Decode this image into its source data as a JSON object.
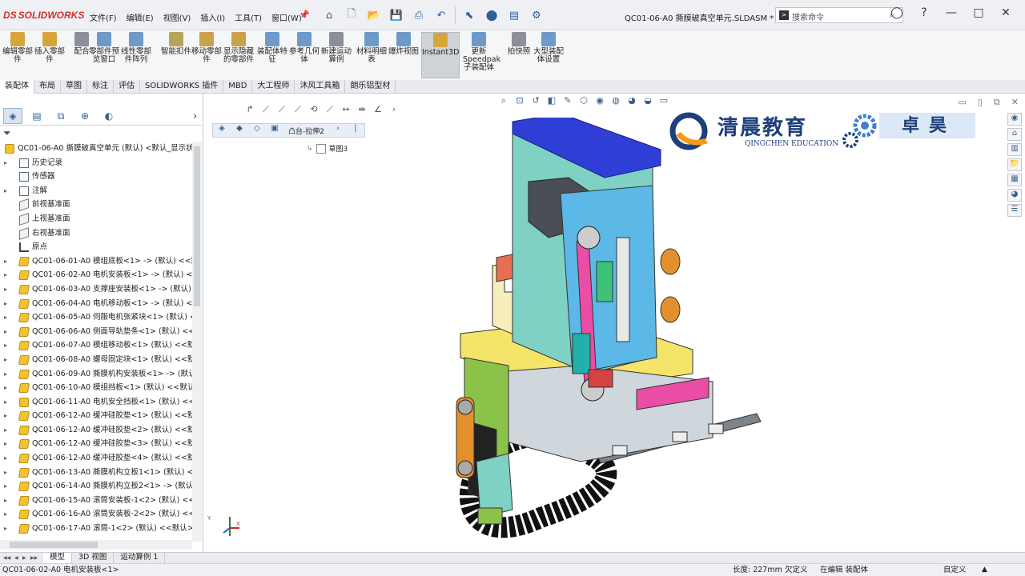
{
  "app": {
    "logo": "SOLIDWORKS",
    "logo_mark": "DS",
    "document_title": "QC01-06-A0 撕膜破真空单元.SLDASM *",
    "search_placeholder": "搜索命令",
    "window_controls": [
      "—",
      "□",
      "✕"
    ]
  },
  "menu": [
    "文件(F)",
    "编辑(E)",
    "视图(V)",
    "插入(I)",
    "工具(T)",
    "窗口(W)"
  ],
  "quick_access": [
    "home-icon",
    "new-icon",
    "open-icon",
    "save-icon",
    "print-icon",
    "undo-icon",
    "select-icon",
    "rebuild-icon",
    "file-properties-icon",
    "options-icon"
  ],
  "ribbon": [
    {
      "label": "编辑零部件",
      "color": "#d8a43c"
    },
    {
      "label": "插入零部件",
      "color": "#d8a43c"
    },
    {
      "label": "配合",
      "color": "#8a8f99"
    },
    {
      "label": "零部件预览窗口",
      "color": "#6d9ac9"
    },
    {
      "label": "线性零部件阵列",
      "color": "#6d9ac9"
    },
    {
      "label": "智能扣件",
      "color": "#b9a35c"
    },
    {
      "label": "移动零部件",
      "color": "#c9a24a"
    },
    {
      "label": "显示隐藏的零部件",
      "color": "#c9a24a"
    },
    {
      "label": "装配体特征",
      "color": "#6d9ac9"
    },
    {
      "label": "参考几何体",
      "color": "#6d9ac9"
    },
    {
      "label": "新建运动算例",
      "color": "#8a8f99"
    },
    {
      "label": "材料明细表",
      "color": "#6d9ac9"
    },
    {
      "label": "爆炸视图",
      "color": "#6d9ac9"
    },
    {
      "label": "Instant3D",
      "color": "#d8a43c"
    },
    {
      "label": "更新Speedpak子装配体",
      "color": "#6d9ac9"
    },
    {
      "label": "拍快照",
      "color": "#8a8f99"
    },
    {
      "label": "大型装配体设置",
      "color": "#6d9ac9"
    }
  ],
  "command_tabs": [
    "装配体",
    "布局",
    "草图",
    "标注",
    "评估",
    "SOLIDWORKS 插件",
    "MBD",
    "大工程师",
    "沐风工具箱",
    "朗乐铝型材"
  ],
  "feature_tree": {
    "root": "QC01-06-A0 撕膜破真空单元 (默认) <默认_显示状",
    "items": [
      {
        "label": "历史记录",
        "type": "folder",
        "expand": "▸"
      },
      {
        "label": "传感器",
        "type": "folder",
        "expand": ""
      },
      {
        "label": "注解",
        "type": "note",
        "expand": "▸"
      },
      {
        "label": "前视基准面",
        "type": "plane",
        "expand": ""
      },
      {
        "label": "上视基准面",
        "type": "plane",
        "expand": ""
      },
      {
        "label": "右视基准面",
        "type": "plane",
        "expand": ""
      },
      {
        "label": "原点",
        "type": "origin",
        "expand": ""
      },
      {
        "label": "QC01-06-01-A0 模组底板<1> -> (默认) <<默",
        "type": "part",
        "expand": "▸"
      },
      {
        "label": "QC01-06-02-A0 电机安装板<1> -> (默认) <",
        "type": "part",
        "expand": "▸"
      },
      {
        "label": "QC01-06-03-A0 支撑座安装板<1> -> (默认)",
        "type": "part",
        "expand": "▸"
      },
      {
        "label": "QC01-06-04-A0 电机移动板<1> -> (默认) <",
        "type": "part",
        "expand": "▸"
      },
      {
        "label": "QC01-06-05-A0 伺服电机张紧块<1> (默认) <",
        "type": "part",
        "expand": "▸"
      },
      {
        "label": "QC01-06-06-A0 侧面导轨垫条<1> (默认) <<",
        "type": "part",
        "expand": "▸"
      },
      {
        "label": "QC01-06-07-A0 模组移动板<1> (默认) <<默",
        "type": "part",
        "expand": "▸"
      },
      {
        "label": "QC01-06-08-A0 螺母固定块<1> (默认) <<默",
        "type": "part",
        "expand": "▸"
      },
      {
        "label": "QC01-06-09-A0 撕膜机构安装板<1> -> (默认",
        "type": "part",
        "expand": "▸"
      },
      {
        "label": "QC01-06-10-A0 模组挡板<1> (默认) <<默认",
        "type": "part",
        "expand": "▸"
      },
      {
        "label": "QC01-06-11-A0 电机安全挡板<1> (默认) <<",
        "type": "asm",
        "expand": "▸"
      },
      {
        "label": "QC01-06-12-A0 缓冲硅胶垫<1> (默认) <<默",
        "type": "part",
        "expand": "▸"
      },
      {
        "label": "QC01-06-12-A0 缓冲硅胶垫<2> (默认) <<默",
        "type": "part",
        "expand": "▸"
      },
      {
        "label": "QC01-06-12-A0 缓冲硅胶垫<3> (默认) <<默",
        "type": "part",
        "expand": "▸"
      },
      {
        "label": "QC01-06-12-A0 缓冲硅胶垫<4> (默认) <<默",
        "type": "part",
        "expand": "▸"
      },
      {
        "label": "QC01-06-13-A0 撕膜机构立板1<1> (默认) <",
        "type": "part",
        "expand": "▸"
      },
      {
        "label": "QC01-06-14-A0 撕膜机构立板2<1> -> (默认",
        "type": "part",
        "expand": "▸"
      },
      {
        "label": "QC01-06-15-A0 滚筒安装板-1<2> (默认) <<",
        "type": "part",
        "expand": "▸"
      },
      {
        "label": "QC01-06-16-A0 滚筒安装板-2<2> (默认) <<",
        "type": "part",
        "expand": "▸"
      },
      {
        "label": "QC01-06-17-A0 滚筒-1<2> (默认) <<默认>_",
        "type": "part",
        "expand": "▸"
      }
    ]
  },
  "viewport": {
    "breadcrumb_label": "凸台-拉伸2",
    "sketch_label": "草图3",
    "brand_cn": "清晨教育",
    "brand_en": "QINGCHEN EDUCATION",
    "brand_cn2": "卓昊",
    "triad_axes": [
      "Y",
      "X"
    ]
  },
  "bottom_tabs": [
    "模型",
    "3D 视图",
    "运动算例 1"
  ],
  "status": {
    "message": "QC01-06-02-A0 电机安装板<1>",
    "length": "长度: 227mm",
    "definition": "欠定义",
    "mode": "在编辑 装配体",
    "units": "自定义",
    "help": "▲"
  },
  "colors": {
    "accent": "#d32f2f",
    "selection_blue": "#4aa3df",
    "brand_blue": "#1e3f7a"
  }
}
